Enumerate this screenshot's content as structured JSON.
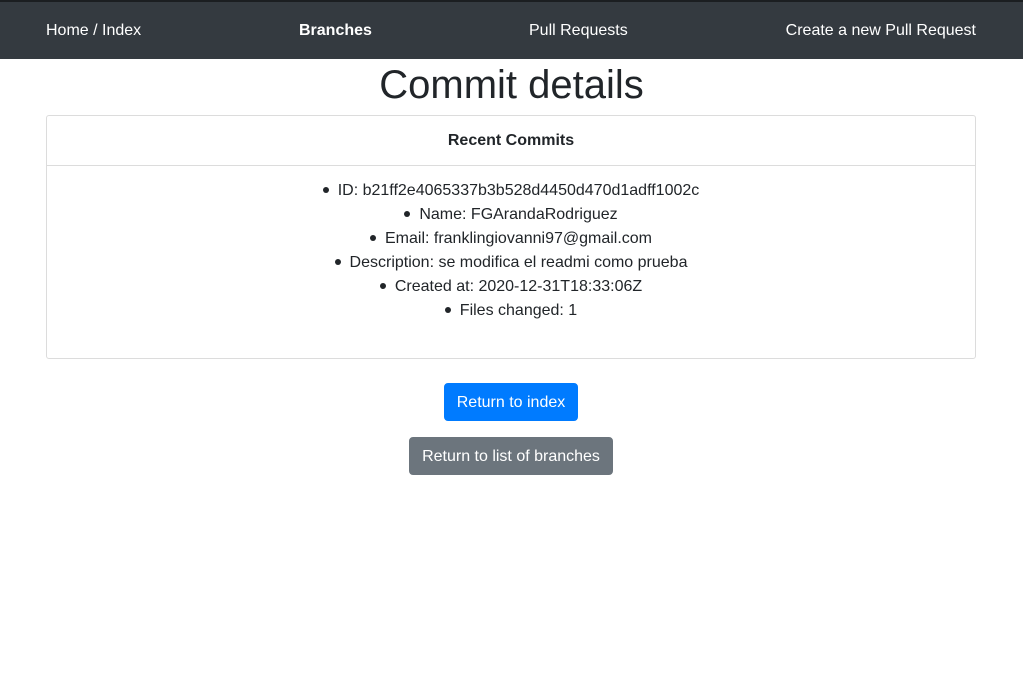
{
  "nav": {
    "home": "Home / Index",
    "branches": "Branches",
    "pull_requests": "Pull Requests",
    "create_pr": "Create a new Pull Request"
  },
  "page": {
    "title": "Commit details"
  },
  "card": {
    "header": "Recent Commits",
    "items": [
      "ID: b21ff2e4065337b3b528d4450d470d1adff1002c",
      "Name: FGArandaRodriguez",
      "Email: franklingiovanni97@gmail.com",
      "Description: se modifica el readmi como prueba",
      "Created at: 2020-12-31T18:33:06Z",
      "Files changed: 1"
    ]
  },
  "buttons": {
    "return_index": "Return to index",
    "return_branches": "Return to list of branches"
  },
  "colors": {
    "navbar": "#343a40",
    "primary": "#007bff",
    "secondary": "#6c757d"
  }
}
